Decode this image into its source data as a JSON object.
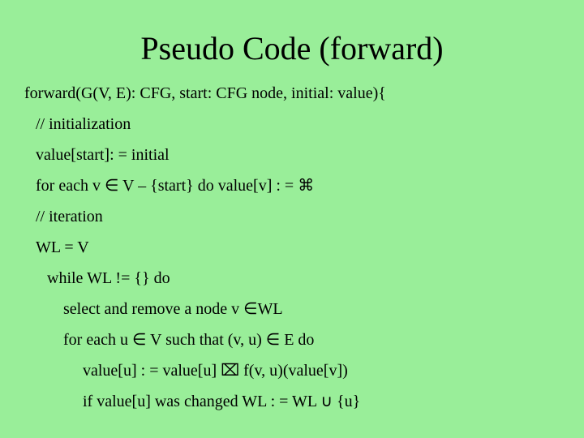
{
  "title": "Pseudo Code (forward)",
  "lines": {
    "l0": "forward(G(V, E): CFG, start: CFG node, initial: value){",
    "l1": "// initialization",
    "l2": "value[start]: = initial",
    "l3": "for each v ∈ V – {start} do value[v] : = ⌘",
    "l4": "// iteration",
    "l5": "WL = V",
    "l6": "while WL != {} do",
    "l7": "select and remove a node v ∈WL",
    "l8": "for each u ∈ V such that (v, u) ∈ E do",
    "l9": "value[u] : = value[u] ⌧ f(v, u)(value[v])",
    "l10": "if value[u] was changed WL : = WL ∪ {u}"
  }
}
